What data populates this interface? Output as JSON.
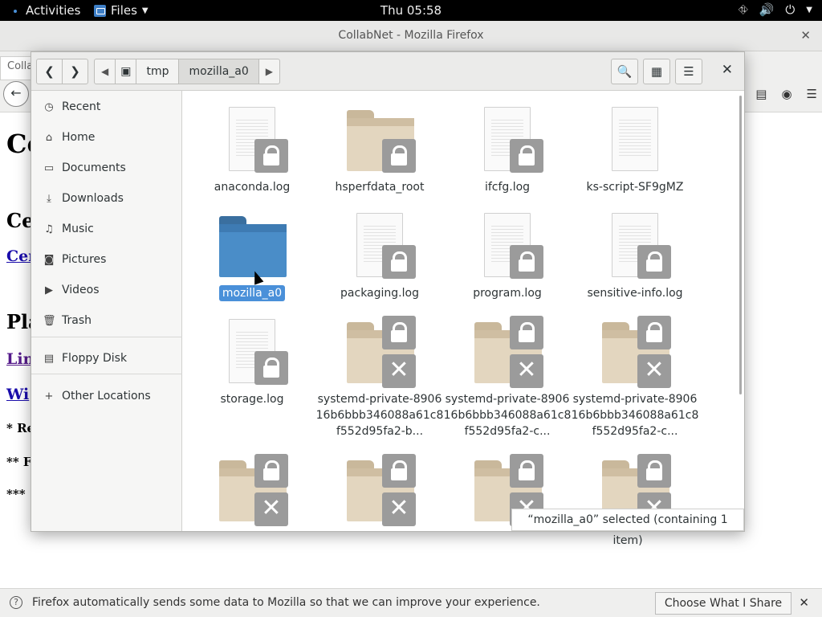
{
  "topbar": {
    "activities": "Activities",
    "app_name": "Files",
    "clock": "Thu 05:58",
    "icons": [
      "network-icon",
      "volume-icon",
      "power-icon"
    ]
  },
  "firefox": {
    "window_title": "CollabNet - Mozilla Firefox",
    "tab_label": "Colla",
    "page_heading": "Co",
    "page_subheading": "Ce",
    "page_link1": "Cer",
    "page_heading2": "Pla",
    "page_link2": "Lin",
    "page_link3": "Wi",
    "page_text1": "* Re",
    "page_text2": "** F",
    "page_text3": "***",
    "notification": {
      "message": "Firefox automatically sends some data to Mozilla so that we can improve your experience.",
      "button": "Choose What I Share"
    }
  },
  "dialog": {
    "breadcrumbs": [
      "tmp",
      "mozilla_a0"
    ],
    "sidebar": [
      {
        "label": "Recent",
        "icon": "clock-icon"
      },
      {
        "label": "Home",
        "icon": "home-icon"
      },
      {
        "label": "Documents",
        "icon": "document-icon"
      },
      {
        "label": "Downloads",
        "icon": "download-icon"
      },
      {
        "label": "Music",
        "icon": "music-icon"
      },
      {
        "label": "Pictures",
        "icon": "camera-icon"
      },
      {
        "label": "Videos",
        "icon": "video-icon"
      },
      {
        "label": "Trash",
        "icon": "trash-icon"
      },
      {
        "label": "Floppy Disk",
        "icon": "disk-icon"
      },
      {
        "label": "Other Locations",
        "icon": "plus-icon"
      }
    ],
    "files": [
      {
        "name": "anaconda.log"
      },
      {
        "name": "hsperfdata_root"
      },
      {
        "name": "ifcfg.log"
      },
      {
        "name": "ks-script-SF9gMZ"
      },
      {
        "name": "mozilla_a0"
      },
      {
        "name": "packaging.log"
      },
      {
        "name": "program.log"
      },
      {
        "name": "sensitive-info.log"
      },
      {
        "name": "storage.log"
      },
      {
        "name": "systemd-private-890616b6bbb346088a61c8f552d95fa2-b..."
      },
      {
        "name": "systemd-private-890616b6bbb346088a61c8f552d95fa2-c..."
      },
      {
        "name": "systemd-private-890616b6bbb346088a61c8f552d95fa2-c..."
      }
    ],
    "status": "“mozilla_a0” selected  (containing 1 item)"
  }
}
